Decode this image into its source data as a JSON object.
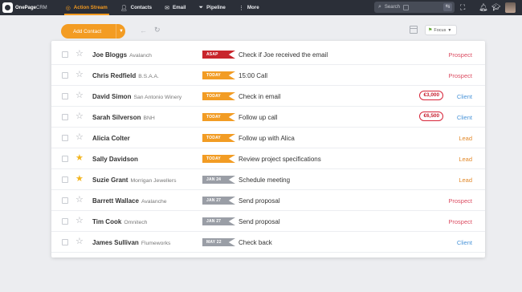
{
  "brand": {
    "name_bold": "OnePage",
    "name_light": "CRM"
  },
  "nav": {
    "items": [
      {
        "label": "Action Stream",
        "icon": "target-icon",
        "active": true
      },
      {
        "label": "Contacts",
        "icon": "person-icon"
      },
      {
        "label": "Email",
        "icon": "envelope-icon"
      },
      {
        "label": "Pipeline",
        "icon": "funnel-icon"
      },
      {
        "label": "More",
        "icon": "more-dots-icon"
      }
    ],
    "search": {
      "placeholder": "Search"
    }
  },
  "toolbar": {
    "add_contact_label": "Add Contact",
    "focus_label": "Focus"
  },
  "colors": {
    "accent": "#f39c23",
    "nav_bg": "#2b2f38",
    "asap": "#c8252c",
    "today": "#f29c24",
    "date": "#9a9ea6",
    "prospect": "#dc4d62",
    "client": "#4b95d9",
    "lead": "#e2892a"
  },
  "rows": [
    {
      "name": "Joe Bloggs",
      "company": "Avalanch",
      "starred": false,
      "tag": "ASAP",
      "tag_type": "asap",
      "action": "Check if Joe received the email",
      "amount": "",
      "status": "Prospect"
    },
    {
      "name": "Chris Redfield",
      "company": "B.S.A.A.",
      "starred": false,
      "tag": "TODAY",
      "tag_type": "today",
      "action": "15:00 Call",
      "amount": "",
      "status": "Prospect"
    },
    {
      "name": "David Simon",
      "company": "San Antonio Winery",
      "starred": false,
      "tag": "TODAY",
      "tag_type": "today",
      "action": "Check in email",
      "amount": "€3,000",
      "status": "Client"
    },
    {
      "name": "Sarah Silverson",
      "company": "BNH",
      "starred": false,
      "tag": "TODAY",
      "tag_type": "today",
      "action": "Follow up call",
      "amount": "€6,500",
      "status": "Client"
    },
    {
      "name": "Alicia Colter",
      "company": "",
      "starred": false,
      "tag": "TODAY",
      "tag_type": "today",
      "action": "Follow up with Alica",
      "amount": "",
      "status": "Lead"
    },
    {
      "name": "Sally Davidson",
      "company": "",
      "starred": true,
      "tag": "TODAY",
      "tag_type": "today",
      "action": "Review project specifications",
      "amount": "",
      "status": "Lead"
    },
    {
      "name": "Suzie Grant",
      "company": "Morrigan Jewellers",
      "starred": true,
      "tag": "JAN 24",
      "tag_type": "date",
      "action": "Schedule meeting",
      "amount": "",
      "status": "Lead"
    },
    {
      "name": "Barrett Wallace",
      "company": "Avalanche",
      "starred": false,
      "tag": "JAN 27",
      "tag_type": "date",
      "action": "Send proposal",
      "amount": "",
      "status": "Prospect"
    },
    {
      "name": "Tim Cook",
      "company": "Omnitech",
      "starred": false,
      "tag": "JAN 27",
      "tag_type": "date",
      "action": "Send proposal",
      "amount": "",
      "status": "Prospect"
    },
    {
      "name": "James Sullivan",
      "company": "Flumeworks",
      "starred": false,
      "tag": "MAY 22",
      "tag_type": "date",
      "action": "Check back",
      "amount": "",
      "status": "Client"
    }
  ]
}
